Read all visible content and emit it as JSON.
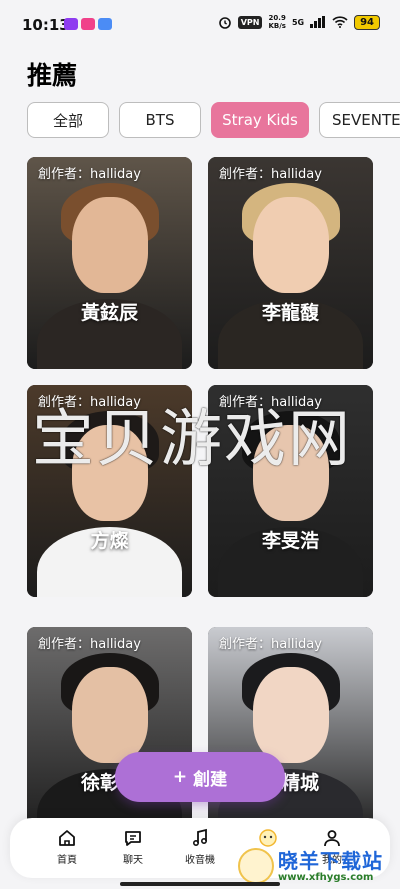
{
  "status_bar": {
    "time": "10:13",
    "vpn": "VPN",
    "speed_value": "20.9",
    "speed_unit": "KB/s",
    "network": "5G",
    "battery": "94"
  },
  "page_title": "推薦",
  "filters": [
    {
      "label": "全部",
      "active": false
    },
    {
      "label": "BTS",
      "active": false
    },
    {
      "label": "Stray Kids",
      "active": true
    },
    {
      "label": "SEVENTE",
      "active": false
    }
  ],
  "cards": [
    {
      "author": "創作者：halliday",
      "name": "黃鉉辰",
      "bg": "#5f5549",
      "hair": "#7a4f2e",
      "skin": "#e2b796",
      "body": "#2b2623"
    },
    {
      "author": "創作者：halliday",
      "name": "李龍馥",
      "bg": "#3b3632",
      "hair": "#d4b57f",
      "skin": "#f0cdb1",
      "body": "#2a2622"
    },
    {
      "author": "創作者：halliday",
      "name": "方燦",
      "bg": "#4c3a2a",
      "hair": "#1e1a18",
      "skin": "#e8c2a5",
      "body": "#f3f3f3"
    },
    {
      "author": "創作者：halliday",
      "name": "李旻浩",
      "bg": "#2f2f2f",
      "hair": "#141414",
      "skin": "#e7c6ae",
      "body": "#1f1f1f"
    },
    {
      "author": "創作者：halliday",
      "name": "徐彰彬",
      "bg": "#6d6c6c",
      "hair": "#191716",
      "skin": "#e4c0a4",
      "body": "#1a1a1a"
    },
    {
      "author": "創作者：halliday",
      "name": "梁精城",
      "bg": "#c9cbd0",
      "hair": "#1b1b1d",
      "skin": "#f1d6c4",
      "body": "#2a2a2e"
    }
  ],
  "watermark_text": "宝贝游戏网",
  "create_button": {
    "icon": "+",
    "label": "創建"
  },
  "nav": [
    {
      "label": "首頁",
      "icon": "home-icon"
    },
    {
      "label": "聊天",
      "icon": "chat-icon"
    },
    {
      "label": "收音機",
      "icon": "music-note-icon"
    },
    {
      "label": "",
      "icon": "mascot-icon"
    },
    {
      "label": "我的",
      "icon": "profile-icon"
    }
  ],
  "site_watermark": {
    "title": "晓羊下载站",
    "url": "www.xfhygs.com"
  }
}
